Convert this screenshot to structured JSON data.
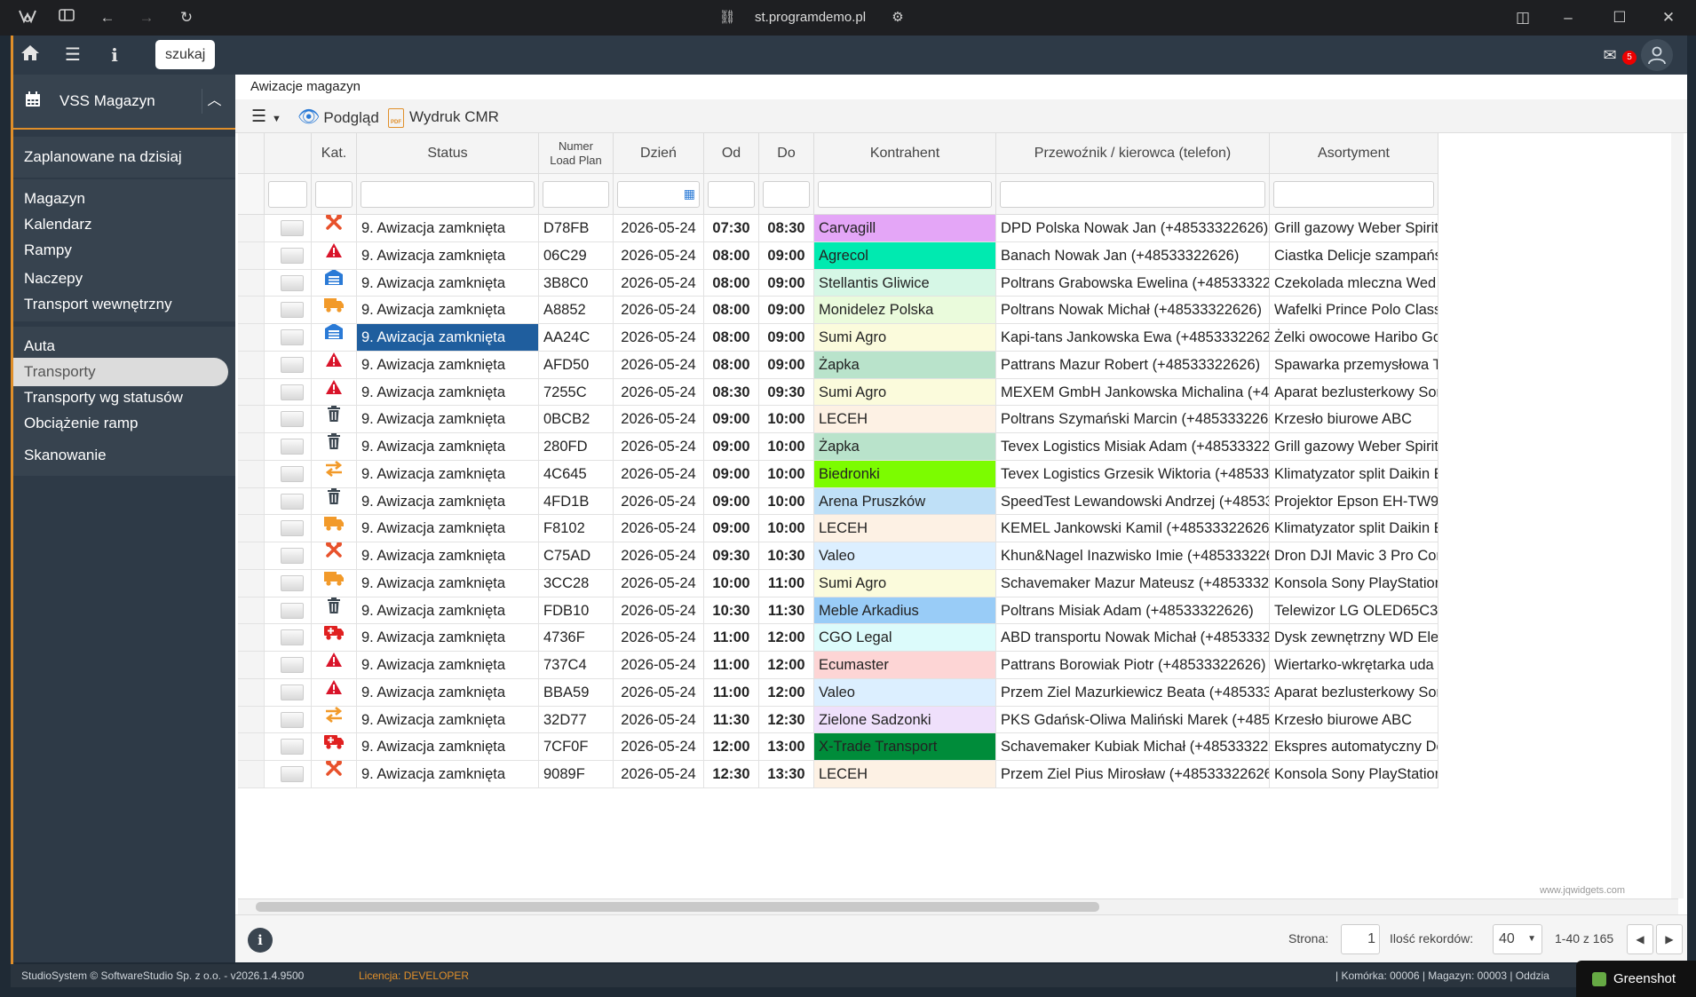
{
  "browser": {
    "url": "st.programdemo.pl"
  },
  "topbar": {
    "search_label": "szukaj",
    "mail_count": "5"
  },
  "sidebar": {
    "title": "VSS Magazyn",
    "groups": [
      [
        "Zaplanowane na dzisiaj"
      ],
      [
        "Magazyn",
        "Kalendarz",
        "Rampy"
      ],
      [
        "Naczepy",
        "Transport wewnętrzny"
      ],
      [
        "Auta",
        "Transporty",
        "Transporty wg statusów",
        "Obciążenie ramp"
      ],
      [
        "Skanowanie"
      ]
    ],
    "active": "Transporty"
  },
  "main": {
    "title": "Awizacje magazyn",
    "toolbar": {
      "preview": "Podgląd",
      "cmr": "Wydruk CMR",
      "pdf": "PDF"
    }
  },
  "grid": {
    "headers": [
      "",
      "Kat.",
      "Status",
      "Numer Load Plan",
      "Dzień",
      "Od",
      "Do",
      "Kontrahent",
      "Przewoźnik / kierowca (telefon)",
      "Asortyment"
    ],
    "selected_row": 4,
    "rows": [
      {
        "kat": "tools",
        "kc": "#e8512b",
        "status": "9. Awizacja zamknięta",
        "num": "D78FB",
        "day": "2026-05-24",
        "od": "07:30",
        "do": "08:30",
        "k": "Carvagill",
        "kcol": "#e4a6f7",
        "p": "DPD Polska Nowak Jan (+48533322626)",
        "a": "Grill gazowy Weber Spirit"
      },
      {
        "kat": "warn",
        "kc": "#d9142a",
        "status": "9. Awizacja zamknięta",
        "num": "06C29",
        "day": "2026-05-24",
        "od": "08:00",
        "do": "09:00",
        "k": "Agrecol",
        "kcol": "#00eab0",
        "p": "Banach Nowak Jan (+48533322626)",
        "a": "Ciastka Delicje szampańs"
      },
      {
        "kat": "garage",
        "kc": "#2a7ad6",
        "status": "9. Awizacja zamknięta",
        "num": "3B8C0",
        "day": "2026-05-24",
        "od": "08:00",
        "do": "09:00",
        "k": "Stellantis Gliwice",
        "kcol": "#d6f7e6",
        "p": "Poltrans Grabowska Ewelina (+48533322626)",
        "a": "Czekolada mleczna Wed"
      },
      {
        "kat": "truck",
        "kc": "#f29a2a",
        "status": "9. Awizacja zamknięta",
        "num": "A8852",
        "day": "2026-05-24",
        "od": "08:00",
        "do": "09:00",
        "k": "Monidelez Polska",
        "kcol": "#eafbdc",
        "p": "Poltrans Nowak Michał (+48533322626)",
        "a": "Wafelki Prince Polo Class"
      },
      {
        "kat": "garage",
        "kc": "#2a7ad6",
        "status": "9. Awizacja zamknięta",
        "num": "AA24C",
        "day": "2026-05-24",
        "od": "08:00",
        "do": "09:00",
        "k": "Sumi Agro",
        "kcol": "#fbfbdc",
        "p": "Kapi-tans Jankowska Ewa (+48533322626)",
        "a": "Żelki owocowe Haribo Go"
      },
      {
        "kat": "warn",
        "kc": "#d9142a",
        "status": "9. Awizacja zamknięta",
        "num": "AFD50",
        "day": "2026-05-24",
        "od": "08:00",
        "do": "09:00",
        "k": "Żapka",
        "kcol": "#b9e3cb",
        "p": "Pattrans Mazur Robert (+48533322626)",
        "a": "Spawarka przemysłowa T"
      },
      {
        "kat": "warn",
        "kc": "#d9142a",
        "status": "9. Awizacja zamknięta",
        "num": "7255C",
        "day": "2026-05-24",
        "od": "08:30",
        "do": "09:30",
        "k": "Sumi Agro",
        "kcol": "#fbfbdc",
        "p": "MEXEM GmbH Jankowska Michalina (+4853…",
        "a": "Aparat bezlusterkowy Sor"
      },
      {
        "kat": "trash",
        "kc": "#3b4650",
        "status": "9. Awizacja zamknięta",
        "num": "0BCB2",
        "day": "2026-05-24",
        "od": "09:00",
        "do": "10:00",
        "k": "LECEH",
        "kcol": "#fdf1e4",
        "p": "Poltrans Szymański Marcin (+48533322626)",
        "a": "Krzesło biurowe ABC"
      },
      {
        "kat": "trash",
        "kc": "#3b4650",
        "status": "9. Awizacja zamknięta",
        "num": "280FD",
        "day": "2026-05-24",
        "od": "09:00",
        "do": "10:00",
        "k": "Żapka",
        "kcol": "#b9e3cb",
        "p": "Tevex Logistics Misiak Adam (+48533322626)",
        "a": "Grill gazowy Weber Spirit"
      },
      {
        "kat": "swap",
        "kc": "#f29a2a",
        "status": "9. Awizacja zamknięta",
        "num": "4C645",
        "day": "2026-05-24",
        "od": "09:00",
        "do": "10:00",
        "k": "Biedronki",
        "kcol": "#7cfc00",
        "p": "Tevex Logistics Grzesik Wiktoria (+48533322…",
        "a": "Klimatyzator split Daikin E"
      },
      {
        "kat": "trash",
        "kc": "#3b4650",
        "status": "9. Awizacja zamknięta",
        "num": "4FD1B",
        "day": "2026-05-24",
        "od": "09:00",
        "do": "10:00",
        "k": "Arena Pruszków",
        "kcol": "#bfe0f7",
        "p": "SpeedTest Lewandowski Andrzej (+4853332…",
        "a": "Projektor Epson EH-TW94"
      },
      {
        "kat": "truck",
        "kc": "#f29a2a",
        "status": "9. Awizacja zamknięta",
        "num": "F8102",
        "day": "2026-05-24",
        "od": "09:00",
        "do": "10:00",
        "k": "LECEH",
        "kcol": "#fdf1e4",
        "p": "KEMEL Jankowski Kamil (+48533322626)",
        "a": "Klimatyzator split Daikin E"
      },
      {
        "kat": "tools",
        "kc": "#e8512b",
        "status": "9. Awizacja zamknięta",
        "num": "C75AD",
        "day": "2026-05-24",
        "od": "09:30",
        "do": "10:30",
        "k": "Valeo",
        "kcol": "#dcefff",
        "p": "Khun&Nagel Inazwisko Imie (+48533322626)",
        "a": "Dron DJI Mavic 3 Pro Com"
      },
      {
        "kat": "truck",
        "kc": "#f29a2a",
        "status": "9. Awizacja zamknięta",
        "num": "3CC28",
        "day": "2026-05-24",
        "od": "10:00",
        "do": "11:00",
        "k": "Sumi Agro",
        "kcol": "#fbfbdc",
        "p": "Schavemaker Mazur Mateusz (+4853332262…",
        "a": "Konsola Sony PlayStation"
      },
      {
        "kat": "trash",
        "kc": "#3b4650",
        "status": "9. Awizacja zamknięta",
        "num": "FDB10",
        "day": "2026-05-24",
        "od": "10:30",
        "do": "11:30",
        "k": "Meble Arkadius",
        "kcol": "#99ccf7",
        "p": "Poltrans Misiak Adam (+48533322626)",
        "a": "Telewizor LG OLED65C3 6!"
      },
      {
        "kat": "ambulance",
        "kc": "#e02020",
        "status": "9. Awizacja zamknięta",
        "num": "4736F",
        "day": "2026-05-24",
        "od": "11:00",
        "do": "12:00",
        "k": "CGO Legal",
        "kcol": "#dcfbfb",
        "p": "ABD transportu Nowak Michał (+485333226…",
        "a": "Dysk zewnętrzny WD Elem"
      },
      {
        "kat": "warn",
        "kc": "#d9142a",
        "status": "9. Awizacja zamknięta",
        "num": "737C4",
        "day": "2026-05-24",
        "od": "11:00",
        "do": "12:00",
        "k": "Ecumaster",
        "kcol": "#fdd5d5",
        "p": "Pattrans Borowiak Piotr (+48533322626)",
        "a": "Wiertarko-wkrętarka uda"
      },
      {
        "kat": "warn",
        "kc": "#d9142a",
        "status": "9. Awizacja zamknięta",
        "num": "BBA59",
        "day": "2026-05-24",
        "od": "11:00",
        "do": "12:00",
        "k": "Valeo",
        "kcol": "#dcefff",
        "p": "Przem Ziel Mazurkiewicz Beata (+485333226…",
        "a": "Aparat bezlusterkowy Sor"
      },
      {
        "kat": "swap",
        "kc": "#f29a2a",
        "status": "9. Awizacja zamknięta",
        "num": "32D77",
        "day": "2026-05-24",
        "od": "11:30",
        "do": "12:30",
        "k": "Zielone Sadzonki",
        "kcol": "#efe0fb",
        "p": "PKS Gdańsk-Oliwa Maliński Marek (+485333…",
        "a": "Krzesło biurowe ABC"
      },
      {
        "kat": "ambulance",
        "kc": "#e02020",
        "status": "9. Awizacja zamknięta",
        "num": "7CF0F",
        "day": "2026-05-24",
        "od": "12:00",
        "do": "13:00",
        "k": "X-Trade Transport",
        "kcol": "#008c3a",
        "p": "Schavemaker Kubiak Michał (+48533322626)",
        "a": "Ekspres automatyczny De"
      },
      {
        "kat": "tools",
        "kc": "#e8512b",
        "status": "9. Awizacja zamknięta",
        "num": "9089F",
        "day": "2026-05-24",
        "od": "12:30",
        "do": "13:30",
        "k": "LECEH",
        "kcol": "#fdf1e4",
        "p": "Przem Ziel Pius Mirosław (+48533322626)",
        "a": "Konsola Sony PlayStation"
      }
    ]
  },
  "watermark": "www.jqwidgets.com",
  "pager": {
    "page_label": "Strona:",
    "page": "1",
    "count_label": "Ilość rekordów:",
    "count": "40",
    "range": "1-40 z 165"
  },
  "statusbar": {
    "left": "StudioSystem © SoftwareStudio Sp. z o.o. - v2026.1.4.9500",
    "license_label": "Licencja:",
    "license": "DEVELOPER",
    "right": "| Komórka: 00006 | Magazyn: 00003 | Oddzia"
  },
  "greenshot": "Greenshot",
  "colors": {
    "accent": "#e08f2a",
    "selected": "#1f5e9e",
    "sidebar": "#2e3a47"
  }
}
